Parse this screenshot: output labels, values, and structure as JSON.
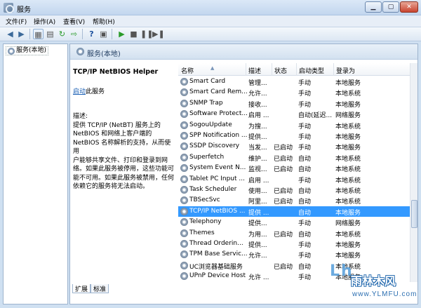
{
  "window": {
    "title": "服务",
    "min": "▁",
    "max": "▢",
    "close": "✕"
  },
  "menu": [
    "文件(F)",
    "操作(A)",
    "查看(V)",
    "帮助(H)"
  ],
  "tree": {
    "label": "服务(本地)"
  },
  "header": {
    "title": "服务(本地)"
  },
  "details": {
    "service_name": "TCP/IP NetBIOS Helper",
    "start_link": "启动",
    "start_suffix": "此服务",
    "description_lines": [
      "描述:",
      "提供 TCP/IP (NetBT) 服务上的",
      "NetBIOS 和网络上客户端的",
      "NetBIOS 名称解析的支持，从而使用",
      "户能够共享文件、打印和登录到网",
      "络。如果此服务被停用，这些功能可",
      "能不可用。如果此服务被禁用，任何",
      "依赖它的服务将无法启动。"
    ]
  },
  "columns": {
    "name": "名称",
    "desc": "描述",
    "status": "状态",
    "startup": "启动类型",
    "logon": "登录为"
  },
  "rows": [
    {
      "name": "Smart Card",
      "desc": "管理...",
      "status": "",
      "startup": "手动",
      "logon": "本地服务"
    },
    {
      "name": "Smart Card Rem...",
      "desc": "允许...",
      "status": "",
      "startup": "手动",
      "logon": "本地系统"
    },
    {
      "name": "SNMP Trap",
      "desc": "接收...",
      "status": "",
      "startup": "手动",
      "logon": "本地服务"
    },
    {
      "name": "Software Protect...",
      "desc": "启用 ...",
      "status": "",
      "startup": "自动(延迟...",
      "logon": "网络服务"
    },
    {
      "name": "SogouUpdate",
      "desc": "为搜...",
      "status": "",
      "startup": "手动",
      "logon": "本地系统"
    },
    {
      "name": "SPP Notification ...",
      "desc": "提供...",
      "status": "",
      "startup": "手动",
      "logon": "本地服务"
    },
    {
      "name": "SSDP Discovery",
      "desc": "当发...",
      "status": "已启动",
      "startup": "手动",
      "logon": "本地服务"
    },
    {
      "name": "Superfetch",
      "desc": "维护...",
      "status": "已启动",
      "startup": "自动",
      "logon": "本地系统"
    },
    {
      "name": "System Event N...",
      "desc": "监视...",
      "status": "已启动",
      "startup": "自动",
      "logon": "本地系统"
    },
    {
      "name": "Tablet PC Input ...",
      "desc": "启用 ...",
      "status": "",
      "startup": "手动",
      "logon": "本地系统"
    },
    {
      "name": "Task Scheduler",
      "desc": "使用...",
      "status": "已启动",
      "startup": "自动",
      "logon": "本地系统"
    },
    {
      "name": "TBSecSvc",
      "desc": "阿里...",
      "status": "已启动",
      "startup": "自动",
      "logon": "本地系统"
    },
    {
      "name": "TCP/IP NetBIOS ...",
      "desc": "提供 ...",
      "status": "",
      "startup": "自动",
      "logon": "本地服务",
      "selected": true
    },
    {
      "name": "Telephony",
      "desc": "提供...",
      "status": "",
      "startup": "手动",
      "logon": "网络服务"
    },
    {
      "name": "Themes",
      "desc": "为用...",
      "status": "已启动",
      "startup": "自动",
      "logon": "本地系统"
    },
    {
      "name": "Thread Orderin...",
      "desc": "提供...",
      "status": "",
      "startup": "手动",
      "logon": "本地服务"
    },
    {
      "name": "TPM Base Servic...",
      "desc": "允许...",
      "status": "",
      "startup": "手动",
      "logon": "本地服务"
    },
    {
      "name": "UC浏览器基础服务",
      "desc": "",
      "status": "已启动",
      "startup": "自动",
      "logon": "本地系统"
    },
    {
      "name": "UPnP Device Host",
      "desc": "允许 ...",
      "status": "",
      "startup": "手动",
      "logon": "本地服务"
    }
  ],
  "tabs": [
    "扩展",
    "标准"
  ],
  "watermark": {
    "logo": "Lh",
    "brand": "雨林木风",
    "url": "www.YLMFU.com"
  },
  "toolbar_icons": [
    "back-icon",
    "forward-icon",
    "show-tree-icon",
    "properties-icon",
    "refresh-icon",
    "export-icon",
    "help-icon",
    "console-icon",
    "start-icon",
    "stop-icon",
    "pause-icon",
    "restart-icon"
  ]
}
